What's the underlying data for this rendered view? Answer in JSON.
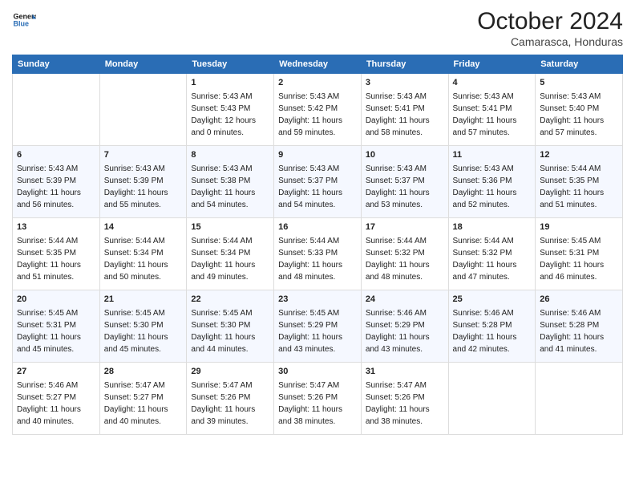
{
  "header": {
    "logo_line1": "General",
    "logo_line2": "Blue",
    "month": "October 2024",
    "location": "Camarasca, Honduras"
  },
  "columns": [
    "Sunday",
    "Monday",
    "Tuesday",
    "Wednesday",
    "Thursday",
    "Friday",
    "Saturday"
  ],
  "weeks": [
    [
      {
        "day": "",
        "text": ""
      },
      {
        "day": "",
        "text": ""
      },
      {
        "day": "1",
        "text": "Sunrise: 5:43 AM\nSunset: 5:43 PM\nDaylight: 12 hours\nand 0 minutes."
      },
      {
        "day": "2",
        "text": "Sunrise: 5:43 AM\nSunset: 5:42 PM\nDaylight: 11 hours\nand 59 minutes."
      },
      {
        "day": "3",
        "text": "Sunrise: 5:43 AM\nSunset: 5:41 PM\nDaylight: 11 hours\nand 58 minutes."
      },
      {
        "day": "4",
        "text": "Sunrise: 5:43 AM\nSunset: 5:41 PM\nDaylight: 11 hours\nand 57 minutes."
      },
      {
        "day": "5",
        "text": "Sunrise: 5:43 AM\nSunset: 5:40 PM\nDaylight: 11 hours\nand 57 minutes."
      }
    ],
    [
      {
        "day": "6",
        "text": "Sunrise: 5:43 AM\nSunset: 5:39 PM\nDaylight: 11 hours\nand 56 minutes."
      },
      {
        "day": "7",
        "text": "Sunrise: 5:43 AM\nSunset: 5:39 PM\nDaylight: 11 hours\nand 55 minutes."
      },
      {
        "day": "8",
        "text": "Sunrise: 5:43 AM\nSunset: 5:38 PM\nDaylight: 11 hours\nand 54 minutes."
      },
      {
        "day": "9",
        "text": "Sunrise: 5:43 AM\nSunset: 5:37 PM\nDaylight: 11 hours\nand 54 minutes."
      },
      {
        "day": "10",
        "text": "Sunrise: 5:43 AM\nSunset: 5:37 PM\nDaylight: 11 hours\nand 53 minutes."
      },
      {
        "day": "11",
        "text": "Sunrise: 5:43 AM\nSunset: 5:36 PM\nDaylight: 11 hours\nand 52 minutes."
      },
      {
        "day": "12",
        "text": "Sunrise: 5:44 AM\nSunset: 5:35 PM\nDaylight: 11 hours\nand 51 minutes."
      }
    ],
    [
      {
        "day": "13",
        "text": "Sunrise: 5:44 AM\nSunset: 5:35 PM\nDaylight: 11 hours\nand 51 minutes."
      },
      {
        "day": "14",
        "text": "Sunrise: 5:44 AM\nSunset: 5:34 PM\nDaylight: 11 hours\nand 50 minutes."
      },
      {
        "day": "15",
        "text": "Sunrise: 5:44 AM\nSunset: 5:34 PM\nDaylight: 11 hours\nand 49 minutes."
      },
      {
        "day": "16",
        "text": "Sunrise: 5:44 AM\nSunset: 5:33 PM\nDaylight: 11 hours\nand 48 minutes."
      },
      {
        "day": "17",
        "text": "Sunrise: 5:44 AM\nSunset: 5:32 PM\nDaylight: 11 hours\nand 48 minutes."
      },
      {
        "day": "18",
        "text": "Sunrise: 5:44 AM\nSunset: 5:32 PM\nDaylight: 11 hours\nand 47 minutes."
      },
      {
        "day": "19",
        "text": "Sunrise: 5:45 AM\nSunset: 5:31 PM\nDaylight: 11 hours\nand 46 minutes."
      }
    ],
    [
      {
        "day": "20",
        "text": "Sunrise: 5:45 AM\nSunset: 5:31 PM\nDaylight: 11 hours\nand 45 minutes."
      },
      {
        "day": "21",
        "text": "Sunrise: 5:45 AM\nSunset: 5:30 PM\nDaylight: 11 hours\nand 45 minutes."
      },
      {
        "day": "22",
        "text": "Sunrise: 5:45 AM\nSunset: 5:30 PM\nDaylight: 11 hours\nand 44 minutes."
      },
      {
        "day": "23",
        "text": "Sunrise: 5:45 AM\nSunset: 5:29 PM\nDaylight: 11 hours\nand 43 minutes."
      },
      {
        "day": "24",
        "text": "Sunrise: 5:46 AM\nSunset: 5:29 PM\nDaylight: 11 hours\nand 43 minutes."
      },
      {
        "day": "25",
        "text": "Sunrise: 5:46 AM\nSunset: 5:28 PM\nDaylight: 11 hours\nand 42 minutes."
      },
      {
        "day": "26",
        "text": "Sunrise: 5:46 AM\nSunset: 5:28 PM\nDaylight: 11 hours\nand 41 minutes."
      }
    ],
    [
      {
        "day": "27",
        "text": "Sunrise: 5:46 AM\nSunset: 5:27 PM\nDaylight: 11 hours\nand 40 minutes."
      },
      {
        "day": "28",
        "text": "Sunrise: 5:47 AM\nSunset: 5:27 PM\nDaylight: 11 hours\nand 40 minutes."
      },
      {
        "day": "29",
        "text": "Sunrise: 5:47 AM\nSunset: 5:26 PM\nDaylight: 11 hours\nand 39 minutes."
      },
      {
        "day": "30",
        "text": "Sunrise: 5:47 AM\nSunset: 5:26 PM\nDaylight: 11 hours\nand 38 minutes."
      },
      {
        "day": "31",
        "text": "Sunrise: 5:47 AM\nSunset: 5:26 PM\nDaylight: 11 hours\nand 38 minutes."
      },
      {
        "day": "",
        "text": ""
      },
      {
        "day": "",
        "text": ""
      }
    ]
  ]
}
